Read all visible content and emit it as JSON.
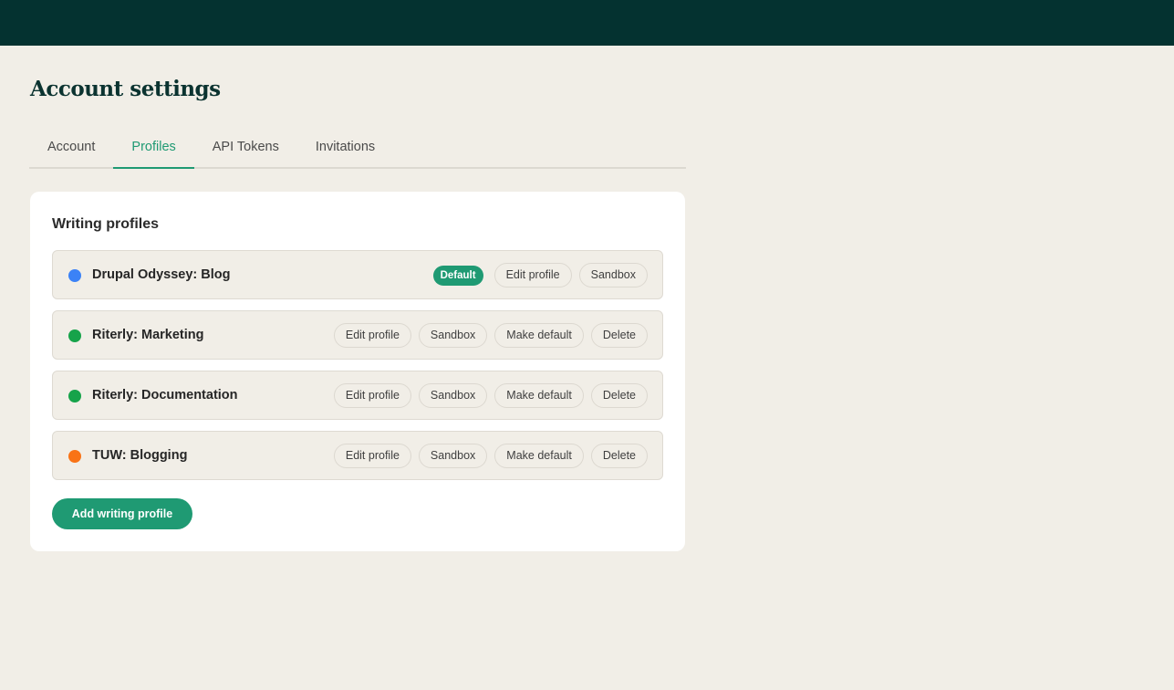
{
  "header": {
    "title": "Account settings"
  },
  "tabs": [
    {
      "label": "Account",
      "active": false
    },
    {
      "label": "Profiles",
      "active": true
    },
    {
      "label": "API Tokens",
      "active": false
    },
    {
      "label": "Invitations",
      "active": false
    }
  ],
  "card": {
    "title": "Writing profiles",
    "add_button_label": "Add writing profile"
  },
  "actions": {
    "default_badge": "Default",
    "edit_label": "Edit profile",
    "sandbox_label": "Sandbox",
    "make_default_label": "Make default",
    "delete_label": "Delete"
  },
  "profiles": [
    {
      "name": "Drupal Odyssey: Blog",
      "color": "#3b82f6",
      "is_default": true
    },
    {
      "name": "Riterly: Marketing",
      "color": "#16a34a",
      "is_default": false
    },
    {
      "name": "Riterly: Documentation",
      "color": "#16a34a",
      "is_default": false
    },
    {
      "name": "TUW: Blogging",
      "color": "#f97316",
      "is_default": false
    }
  ],
  "colors": {
    "accent": "#1f9a73",
    "topbar": "#043230",
    "background": "#f1eee7"
  }
}
